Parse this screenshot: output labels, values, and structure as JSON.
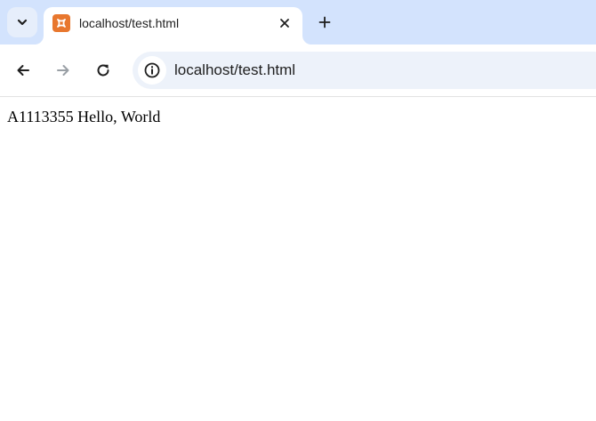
{
  "browser": {
    "tab": {
      "title": "localhost/test.html",
      "favicon": "xampp-icon",
      "favicon_color": "#e8772e"
    },
    "address_bar": {
      "url": "localhost/test.html"
    },
    "icons": {
      "tab_search": "chevron-down-icon",
      "tab_close": "close-icon",
      "new_tab": "plus-icon",
      "back": "arrow-left-icon",
      "forward": "arrow-right-icon",
      "reload": "reload-icon",
      "site_info": "info-icon"
    },
    "colors": {
      "tabstrip": "#d3e3fd",
      "omnibox": "#edf2fa"
    }
  },
  "page": {
    "text": "A1113355 Hello, World"
  }
}
